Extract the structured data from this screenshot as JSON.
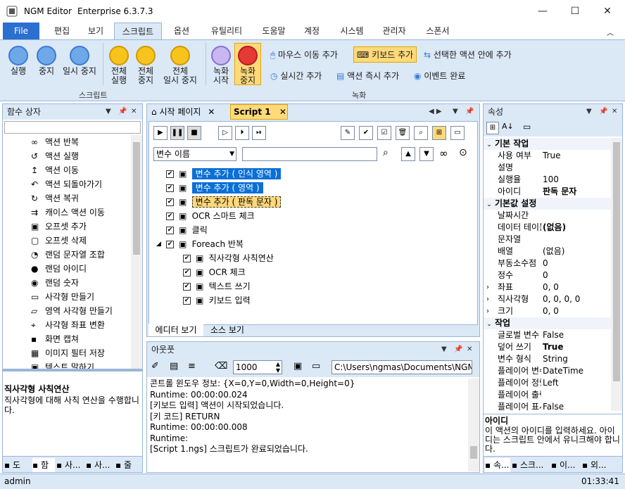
{
  "window": {
    "app_name": "NGM Editor",
    "edition": "Enterprise 6.3.7.3",
    "min": "—",
    "max": "☐",
    "close": "✕"
  },
  "tabs": [
    "File",
    "편집",
    "보기",
    "스크립트",
    "옵션",
    "유틸리티",
    "도움말",
    "계정",
    "시스템",
    "관리자",
    "스폰서"
  ],
  "ribbon": {
    "run": "실행",
    "stop": "중지",
    "pause": "일시 중지",
    "all_run": [
      "전체",
      "실행"
    ],
    "all_stop": [
      "전체",
      "중지"
    ],
    "all_pause": [
      "전체",
      "일시 중지"
    ],
    "rec_start": [
      "녹화",
      "시작"
    ],
    "rec_stop": [
      "녹화",
      "중지"
    ],
    "mouse_move": "마우스 이동 추가",
    "keyboard_add": "키보드 추가",
    "in_action": "선택한 액션 안에 추가",
    "realtime": "실시간 추가",
    "action_add": "액션 즉시 추가",
    "event_done": "이벤트 완료",
    "group_script": "스크립트",
    "group_record": "녹화"
  },
  "left_panel": {
    "title": "함수 상자",
    "items": [
      "액션 반복",
      "액션 실행",
      "액션 이동",
      "액션 되돌아가기",
      "액션 복귀",
      "캐이스 액션 이동",
      "오프셋 추가",
      "오프셋 삭제",
      "랜덤 문자열 조합",
      "랜덤 아이디",
      "랜덤 숫자",
      "사각형 만들기",
      "영역 사각형 만들기",
      "사각형 좌표 변환",
      "화면 캡쳐",
      "이미지 필터 저장",
      "텍스트 말하기"
    ],
    "desc_title": "직사각형 사칙연산",
    "desc_text": "직사각형에 대해 사칙 연산을 수행합니다.",
    "bottom_tabs": [
      "도",
      "함",
      "사...",
      "사...",
      "줄"
    ]
  },
  "editor": {
    "tabs": [
      "시작 페이지",
      "Script 1"
    ],
    "var_select": "변수 이름",
    "tree": [
      {
        "label": "변수 추가 ( 인식 영역 )",
        "style": "selected"
      },
      {
        "label": "변수 추가 ( 영역 )",
        "style": "selected"
      },
      {
        "label": "변수 추가 ( 판독 문자 )",
        "style": "highlight"
      },
      {
        "label": "OCR 스마트 체크",
        "style": "normal"
      },
      {
        "label": "클릭",
        "style": "normal"
      },
      {
        "label": "Foreach 반복",
        "style": "normal"
      },
      {
        "label": "직사각형 사칙연산",
        "style": "child"
      },
      {
        "label": "OCR 체크",
        "style": "child"
      },
      {
        "label": "텍스트 쓰기",
        "style": "child"
      },
      {
        "label": "키보드 입력",
        "style": "child"
      }
    ],
    "bottom_tabs": [
      "에디터 보기",
      "소스 보기"
    ]
  },
  "output": {
    "title": "아웃풋",
    "count": "1000",
    "path": "C:\\Users\\ngmas\\Documents\\NGM6\\",
    "lines": [
      "콘트롤 윈도우 정보: {X=0,Y=0,Width=0,Height=0}",
      "Runtime: 00:00:00.024",
      "[키보드 입력] 액션이 시작되었습니다.",
      "[키 코드] RETURN",
      "Runtime: 00:00:00.008",
      "Runtime:",
      "[Script 1.ngs] 스크립트가 완료되었습니다."
    ]
  },
  "properties": {
    "title": "속성",
    "rows": [
      {
        "type": "cat",
        "name": "기본 작업"
      },
      {
        "type": "row",
        "name": "사용 여부",
        "value": "True"
      },
      {
        "type": "row",
        "name": "설명",
        "value": ""
      },
      {
        "type": "row",
        "name": "실행율",
        "value": "100"
      },
      {
        "type": "row",
        "name": "아이디",
        "value": "판독 문자",
        "bold": true
      },
      {
        "type": "cat",
        "name": "기본값 설정"
      },
      {
        "type": "row",
        "name": "날짜시간",
        "value": ""
      },
      {
        "type": "row",
        "name": "데이터 테이블",
        "value": "(없음)",
        "bold": true
      },
      {
        "type": "row",
        "name": "문자열",
        "value": ""
      },
      {
        "type": "row",
        "name": "배열",
        "value": "(없음)"
      },
      {
        "type": "row",
        "name": "부동소수점",
        "value": "0"
      },
      {
        "type": "row",
        "name": "정수",
        "value": "0"
      },
      {
        "type": "row",
        "name": "좌표",
        "value": "0, 0",
        "exp": true
      },
      {
        "type": "row",
        "name": "직사각형",
        "value": "0, 0, 0, 0",
        "exp": true
      },
      {
        "type": "row",
        "name": "크기",
        "value": "0, 0",
        "exp": true
      },
      {
        "type": "cat",
        "name": "작업"
      },
      {
        "type": "row",
        "name": "글로벌 변수",
        "value": "False"
      },
      {
        "type": "row",
        "name": "덮어 쓰기",
        "value": "True",
        "bold": true
      },
      {
        "type": "row",
        "name": "변수 형식",
        "value": "String"
      },
      {
        "type": "row",
        "name": "플레이어 변수",
        "value": "DateTime"
      },
      {
        "type": "row",
        "name": "플레이어 정렬",
        "value": "Left"
      },
      {
        "type": "row",
        "name": "플레이어 출력",
        "value": ""
      },
      {
        "type": "row",
        "name": "플레이어 표시",
        "value": "False"
      }
    ],
    "desc_title": "아이디",
    "desc_text": "이 액션의 아이디를 입력하세요. 아이디는 스크립트 안에서 유니크해야 합니다.",
    "bottom_tabs": [
      "속...",
      "스크...",
      "이...",
      "외..."
    ]
  },
  "status": {
    "user": "admin",
    "time": "01:33:41"
  }
}
